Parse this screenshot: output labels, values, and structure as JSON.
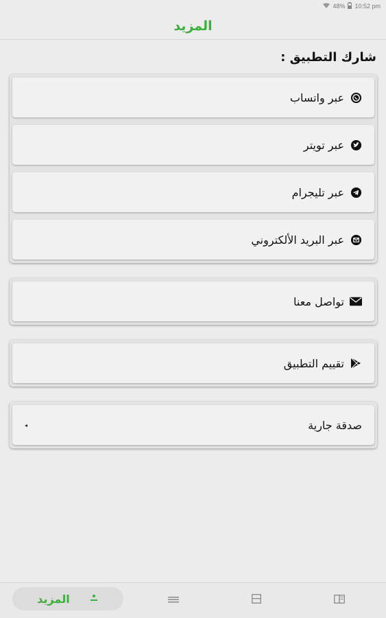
{
  "status_bar": {
    "battery": "48%",
    "time": "10:52 pm"
  },
  "header": {
    "title": "المزيد"
  },
  "share": {
    "heading": "شارك التطبيق :",
    "items": [
      {
        "label": "عبر واتساب",
        "icon": "whatsapp-icon"
      },
      {
        "label": "عبر تويتر",
        "icon": "twitter-icon"
      },
      {
        "label": "عبر تليجرام",
        "icon": "telegram-icon"
      },
      {
        "label": "عبر البريد الألكتروني",
        "icon": "email-circle-icon"
      }
    ]
  },
  "contact": {
    "label": "تواصل معنا",
    "icon": "envelope-icon"
  },
  "rate": {
    "label": "تقييم التطبيق",
    "icon": "play-store-icon"
  },
  "charity": {
    "label": "صدقة جارية",
    "icon": "chevron-left-icon"
  },
  "bottom_nav": {
    "active_label": "المزيد",
    "items": [
      "more-icon",
      "list-icon",
      "grid-icon",
      "book-icon"
    ]
  },
  "colors": {
    "accent": "#3bb03b",
    "background": "#ececec",
    "card": "#f1f1f1"
  }
}
